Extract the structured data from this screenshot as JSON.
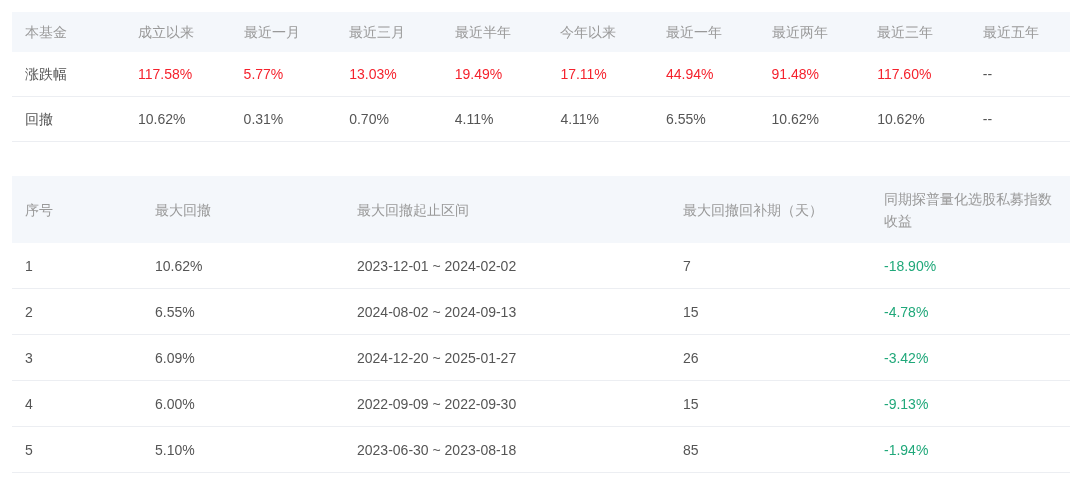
{
  "summary_table": {
    "columns": [
      "本基金",
      "成立以来",
      "最近一月",
      "最近三月",
      "最近半年",
      "今年以来",
      "最近一年",
      "最近两年",
      "最近三年",
      "最近五年"
    ],
    "rows": [
      {
        "cells": [
          {
            "text": "涨跌幅"
          },
          {
            "text": "117.58%",
            "color": "#f5222d"
          },
          {
            "text": "5.77%",
            "color": "#f5222d"
          },
          {
            "text": "13.03%",
            "color": "#f5222d"
          },
          {
            "text": "19.49%",
            "color": "#f5222d"
          },
          {
            "text": "17.11%",
            "color": "#f5222d"
          },
          {
            "text": "44.94%",
            "color": "#f5222d"
          },
          {
            "text": "91.48%",
            "color": "#f5222d"
          },
          {
            "text": "117.60%",
            "color": "#f5222d"
          },
          {
            "text": "--"
          }
        ]
      },
      {
        "cells": [
          {
            "text": "回撤"
          },
          {
            "text": "10.62%"
          },
          {
            "text": "0.31%"
          },
          {
            "text": "0.70%"
          },
          {
            "text": "4.11%"
          },
          {
            "text": "4.11%"
          },
          {
            "text": "6.55%"
          },
          {
            "text": "10.62%"
          },
          {
            "text": "10.62%"
          },
          {
            "text": "--"
          }
        ]
      }
    ]
  },
  "drawdown_table": {
    "columns": [
      "序号",
      "最大回撤",
      "最大回撤起止区间",
      "最大回撤回补期（天）",
      "同期探普量化选股私募指数收益"
    ],
    "rows": [
      {
        "cells": [
          {
            "text": "1"
          },
          {
            "text": "10.62%"
          },
          {
            "text": "2023-12-01 ~ 2024-02-02"
          },
          {
            "text": "7"
          },
          {
            "text": "-18.90%",
            "color": "#20a87a"
          }
        ]
      },
      {
        "cells": [
          {
            "text": "2"
          },
          {
            "text": "6.55%"
          },
          {
            "text": "2024-08-02 ~ 2024-09-13"
          },
          {
            "text": "15"
          },
          {
            "text": "-4.78%",
            "color": "#20a87a"
          }
        ]
      },
      {
        "cells": [
          {
            "text": "3"
          },
          {
            "text": "6.09%"
          },
          {
            "text": "2024-12-20 ~ 2025-01-27"
          },
          {
            "text": "26"
          },
          {
            "text": "-3.42%",
            "color": "#20a87a"
          }
        ]
      },
      {
        "cells": [
          {
            "text": "4"
          },
          {
            "text": "6.00%"
          },
          {
            "text": "2022-09-09 ~ 2022-09-30"
          },
          {
            "text": "15"
          },
          {
            "text": "-9.13%",
            "color": "#20a87a"
          }
        ]
      },
      {
        "cells": [
          {
            "text": "5"
          },
          {
            "text": "5.10%"
          },
          {
            "text": "2023-06-30 ~ 2023-08-18"
          },
          {
            "text": "85"
          },
          {
            "text": "-1.94%",
            "color": "#20a87a"
          }
        ]
      }
    ]
  }
}
